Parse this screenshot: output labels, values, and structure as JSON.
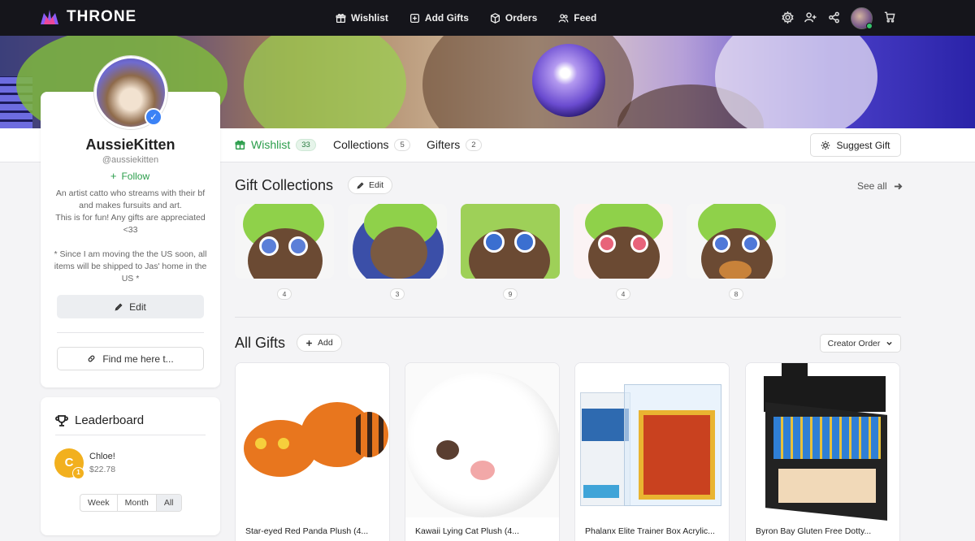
{
  "nav": {
    "brand": "THRONE",
    "links": [
      {
        "label": "Wishlist",
        "icon": "gift-icon"
      },
      {
        "label": "Add Gifts",
        "icon": "plus-square-icon"
      },
      {
        "label": "Orders",
        "icon": "box-icon"
      },
      {
        "label": "Feed",
        "icon": "users-icon"
      }
    ],
    "right_icons": [
      "gear-icon",
      "add-user-icon",
      "share-icon",
      "avatar",
      "cart-icon"
    ]
  },
  "profile": {
    "name": "AussieKitten",
    "handle": "@aussiekitten",
    "follow_label": "Follow",
    "bio": "An artist catto who streams with their bf and makes fursuits and art.\nThis is for fun! Any gifts are appreciated <33\n\n* Since I am moving the the US soon, all items will be shipped to Jas' home in the US *",
    "edit_label": "Edit",
    "find_label": "Find me here t..."
  },
  "leaderboard": {
    "title": "Leaderboard",
    "entries": [
      {
        "initial": "C",
        "rank": "1",
        "name": "Chloe!",
        "amount": "$22.78"
      }
    ],
    "tabs": [
      "Week",
      "Month",
      "All"
    ],
    "active_tab": "All"
  },
  "tabs": [
    {
      "label": "Wishlist",
      "count": "33",
      "active": true
    },
    {
      "label": "Collections",
      "count": "5"
    },
    {
      "label": "Gifters",
      "count": "2"
    }
  ],
  "suggest_label": "Suggest Gift",
  "collections": {
    "title": "Gift Collections",
    "edit_label": "Edit",
    "see_all": "See all",
    "items": [
      {
        "count": "4"
      },
      {
        "count": "3"
      },
      {
        "count": "9"
      },
      {
        "count": "4"
      },
      {
        "count": "8"
      }
    ]
  },
  "gifts": {
    "title": "All Gifts",
    "add_label": "Add",
    "order_label": "Creator Order",
    "items": [
      {
        "title": "Star-eyed Red Panda Plush (4..."
      },
      {
        "title": "Kawaii Lying Cat Plush (4..."
      },
      {
        "title": "Phalanx Elite Trainer Box Acrylic..."
      },
      {
        "title": "Byron Bay Gluten Free Dotty..."
      }
    ]
  },
  "colors": {
    "accent_green": "#2a9d4a",
    "nav_bg": "#15151b",
    "gold": "#f2b01e",
    "verified_blue": "#3b82f6"
  }
}
